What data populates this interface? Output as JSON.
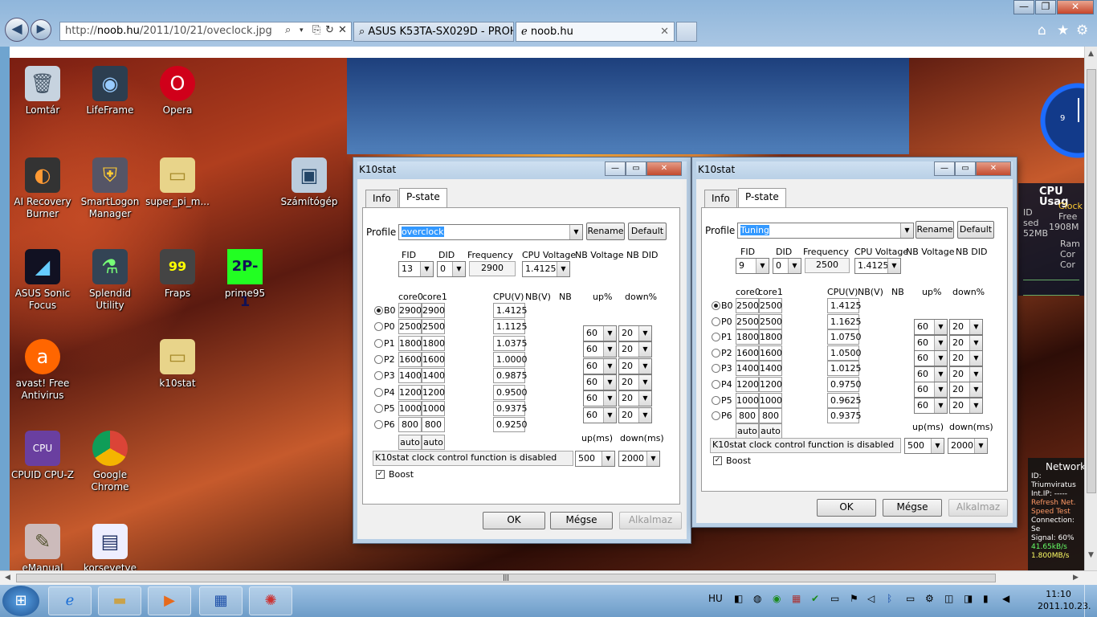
{
  "browser": {
    "url_prefix": "http://",
    "url_host": "noob.hu",
    "url_path": "/2011/10/21/oveclock.jpg",
    "tabs": [
      "ASUS K53TA-SX029D - PROHA...",
      "noob.hu"
    ]
  },
  "desktop": {
    "icons": [
      "Lomtár",
      "LifeFrame",
      "Opera",
      "AI Recovery Burner",
      "SmartLogon Manager",
      "super_pi_m...",
      "Számítógép",
      "ASUS Sonic Focus",
      "Splendid Utility",
      "Fraps",
      "prime95",
      "avast! Free Antivirus",
      "k10stat",
      "CPUID CPU-Z",
      "Google Chrome",
      "eManual",
      "korsevetve"
    ],
    "fraps_badge": "99",
    "prime_text": "2P-1"
  },
  "gadgets": {
    "cpu_title": "CPU Usag",
    "cpu_lines": [
      "ID",
      "sed",
      "52MB"
    ],
    "cpu_clock": "Clock",
    "cpu_free": "Free",
    "cpu_mem": "1908M",
    "cpu_rows": [
      "Ram",
      "Cor",
      "Cor"
    ],
    "net_title": "Network",
    "net_lines": [
      "ID: Triumviratus",
      "Int.IP: -----",
      "Refresh Net.",
      "Speed Test",
      "Connection: Se",
      "Signal: 60%",
      "41.65kB/s",
      "1.800MB/s"
    ]
  },
  "dlg1": {
    "title": "K10stat",
    "tabs": [
      "Info",
      "P-state"
    ],
    "profile_label": "Profile",
    "profile": "overclock",
    "rename": "Rename",
    "default": "Default",
    "headers": [
      "FID",
      "DID",
      "Frequency",
      "CPU Voltage",
      "NB Voltage",
      "NB DID"
    ],
    "fid": "13",
    "did": "0",
    "freq": "2900",
    "volt": "1.4125",
    "col_heads": [
      "core0",
      "core1",
      "CPU(V)",
      "NB(V)",
      "NB",
      "up%",
      "down%"
    ],
    "states": [
      "B0",
      "P0",
      "P1",
      "P2",
      "P3",
      "P4",
      "P5",
      "P6"
    ],
    "core0": [
      "2900",
      "2500",
      "1800",
      "1600",
      "1400",
      "1200",
      "1000",
      "800"
    ],
    "core1": [
      "2900",
      "2500",
      "1800",
      "1600",
      "1400",
      "1200",
      "1000",
      "800"
    ],
    "cpuv": [
      "1.4125",
      "1.1125",
      "1.0375",
      "1.0000",
      "0.9875",
      "0.9500",
      "0.9375",
      "0.9250"
    ],
    "up": [
      "60",
      "60",
      "60",
      "60",
      "60",
      "60"
    ],
    "down": [
      "20",
      "20",
      "20",
      "20",
      "20",
      "20"
    ],
    "auto": "auto",
    "upms_label": "up(ms)",
    "downms_label": "down(ms)",
    "status": "K10stat clock control function is disabled",
    "upms": "500",
    "downms": "2000",
    "boost": "Boost",
    "ok": "OK",
    "cancel": "Mégse",
    "apply": "Alkalmaz"
  },
  "dlg2": {
    "title": "K10stat",
    "tabs": [
      "Info",
      "P-state"
    ],
    "profile_label": "Profile",
    "profile": "Tuning",
    "rename": "Rename",
    "default": "Default",
    "headers": [
      "FID",
      "DID",
      "Frequency",
      "CPU Voltage",
      "NB Voltage",
      "NB DID"
    ],
    "fid": "9",
    "did": "0",
    "freq": "2500",
    "volt": "1.4125",
    "col_heads": [
      "core0",
      "core1",
      "CPU(V)",
      "NB(V)",
      "NB",
      "up%",
      "down%"
    ],
    "states": [
      "B0",
      "P0",
      "P1",
      "P2",
      "P3",
      "P4",
      "P5",
      "P6"
    ],
    "core0": [
      "2500",
      "2500",
      "1800",
      "1600",
      "1400",
      "1200",
      "1000",
      "800"
    ],
    "core1": [
      "2500",
      "2500",
      "1800",
      "1600",
      "1400",
      "1200",
      "1000",
      "800"
    ],
    "cpuv": [
      "1.4125",
      "1.1625",
      "1.0750",
      "1.0500",
      "1.0125",
      "0.9750",
      "0.9625",
      "0.9375"
    ],
    "up": [
      "60",
      "60",
      "60",
      "60",
      "60",
      "60"
    ],
    "down": [
      "20",
      "20",
      "20",
      "20",
      "20",
      "20"
    ],
    "auto": "auto",
    "upms_label": "up(ms)",
    "downms_label": "down(ms)",
    "status": "K10stat clock control function is disabled",
    "upms": "500",
    "downms": "2000",
    "boost": "Boost",
    "ok": "OK",
    "cancel": "Mégse",
    "apply": "Alkalmaz"
  },
  "taskbar": {
    "lang": "HU",
    "time": "11:10",
    "date": "2011.10.23."
  }
}
